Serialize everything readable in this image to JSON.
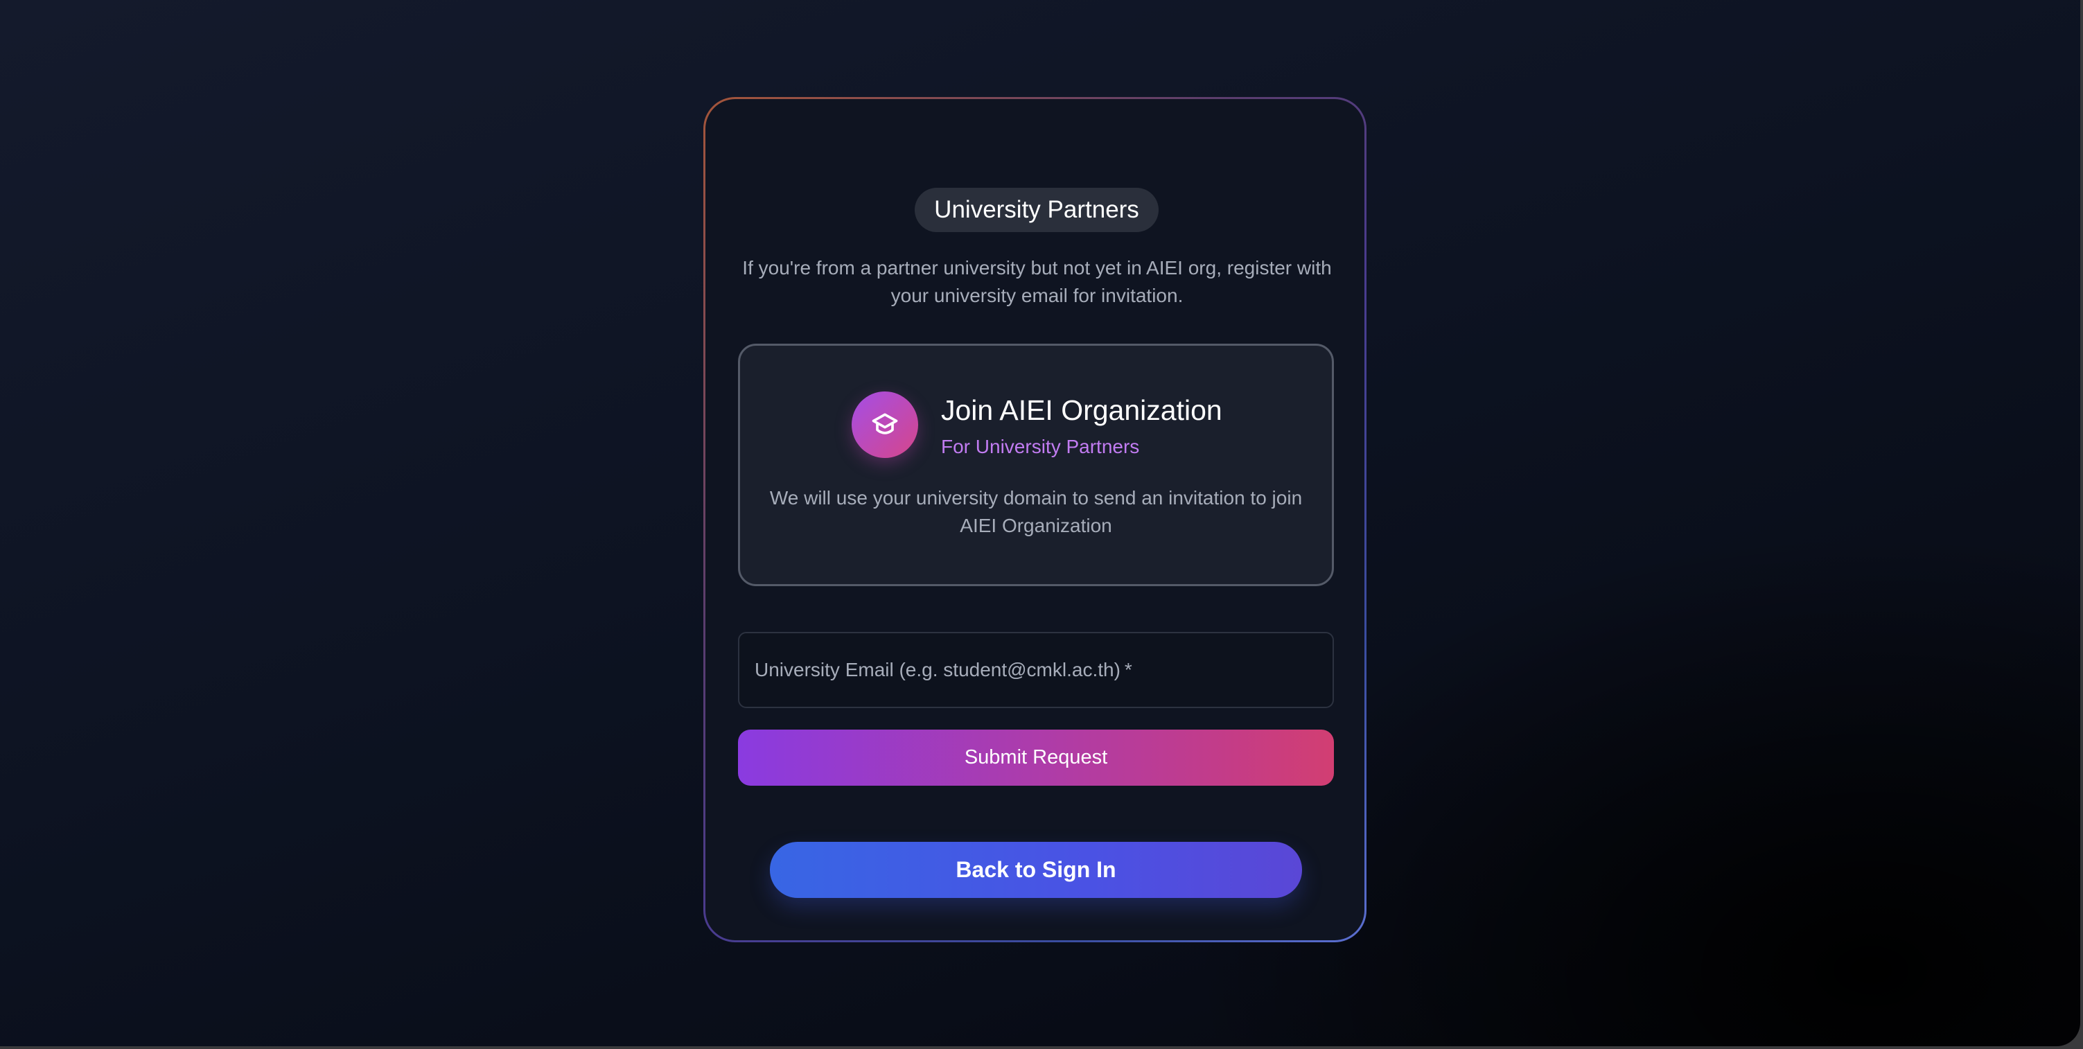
{
  "pill": {
    "label": "University Partners"
  },
  "intro": {
    "text": "If you're from a partner university but not yet in AIEI org, register with your university email for invitation."
  },
  "join_card": {
    "icon": "graduation-cap-icon",
    "title": "Join AIEI Organization",
    "subtitle": "For University Partners",
    "description": "We will use your university domain to send an invitation to join AIEI Organization"
  },
  "email": {
    "label": "University Email (e.g. student@cmkl.ac.th)",
    "required_marker": "*",
    "value": ""
  },
  "submit": {
    "label": "Submit Request"
  },
  "back": {
    "label": "Back to Sign In"
  },
  "colors": {
    "accent_purple": "#8a3be0",
    "accent_pink": "#d23e72",
    "accent_blue": "#3866e4",
    "subtitle_purple": "#c27cf2",
    "background": "#0d1322"
  }
}
